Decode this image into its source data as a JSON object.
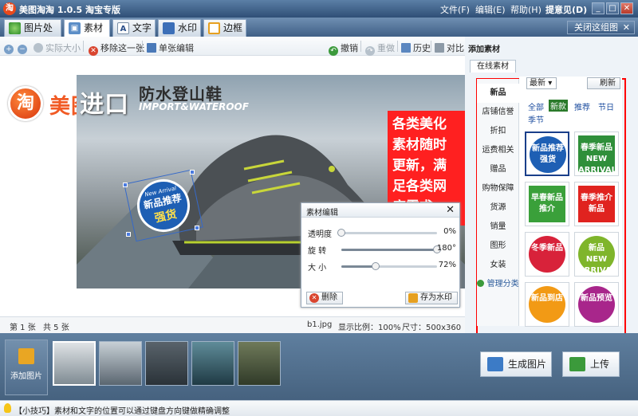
{
  "window": {
    "title": "美图淘淘 1.0.5 淘宝专版",
    "logo_char": "淘",
    "menu": [
      "文件(F)",
      "编辑(E)",
      "帮助(H)",
      "提意见(D)"
    ],
    "controls": [
      "_",
      "□",
      "✕"
    ]
  },
  "tabs": [
    {
      "label": "图片处理",
      "active": false
    },
    {
      "label": "素材",
      "active": true
    },
    {
      "label": "文字",
      "active": false
    },
    {
      "label": "水印",
      "active": false
    },
    {
      "label": "边框",
      "active": false
    }
  ],
  "close_panel_label": "关闭这组图",
  "toolbar": {
    "actual_size": "实际大小",
    "remove_one": "移除这一张",
    "single_edit": "单张编辑",
    "undo": "撤销",
    "redo": "重做",
    "history": "历史",
    "compare": "对比"
  },
  "canvas": {
    "brand_char": "淘",
    "brand_name": "美图淘淘",
    "headline_big": "进口",
    "headline_small": "防水登山鞋",
    "subhead": "IMPORT&WATEROOF",
    "sticker_small": "New Arrival",
    "sticker_mid": "新品推荐",
    "sticker_big": "强货"
  },
  "promo_lines": [
    "各类美化",
    "素材随时",
    "更新，满",
    "足各类网",
    "店需求"
  ],
  "status": {
    "page": "第 1 张",
    "total": "共 5 张",
    "file": "b1.jpg",
    "zoom": "显示比例：100%",
    "size": "尺寸：500x360"
  },
  "material_editor": {
    "title": "素材编辑",
    "close": "✕",
    "rows": [
      {
        "label": "透明度",
        "value": "0%",
        "level": 0.0
      },
      {
        "label": "旋 转",
        "value": "180°",
        "level": 1.0
      },
      {
        "label": "大 小",
        "value": "72%",
        "level": 0.36
      }
    ],
    "delete_label": "删除",
    "save_watermark_label": "存为水印"
  },
  "right_panel": {
    "title": "添加素材",
    "online_tab": "在线素材",
    "sort": "最新",
    "refresh": "刷新",
    "categories": [
      "新品",
      "店铺信誉",
      "折扣",
      "运费相关",
      "赠品",
      "购物保障",
      "货源",
      "销量",
      "图形",
      "女装",
      "管理分类"
    ],
    "active_category": "新品",
    "filters": [
      "全部",
      "新款",
      "推荐",
      "节日",
      "季节"
    ],
    "active_filter": "新款",
    "tiles": [
      {
        "text": "新品推荐强货",
        "color": "#1e5fb4"
      },
      {
        "text": "春季新品NEW ARRIVAL",
        "color": "#2f8f3a"
      },
      {
        "text": "早春新品推介",
        "color": "#3aa03a"
      },
      {
        "text": "春季推介新品",
        "color": "#e0231f"
      },
      {
        "text": "冬季新品",
        "color": "#d8223a"
      },
      {
        "text": "新品NEW ARRIVAL",
        "color": "#7fb52b"
      },
      {
        "text": "新品到店",
        "color": "#f29a15"
      },
      {
        "text": "新品预览",
        "color": "#a8268b"
      }
    ]
  },
  "strip": {
    "add_label": "添加图片",
    "thumb_count": 5
  },
  "buttons": {
    "generate": "生成图片",
    "upload": "上传"
  },
  "tip": "【小技巧】素材和文字的位置可以通过键盘方向键做精确调整",
  "colors": {
    "accent_red": "#ff2020",
    "brand_orange": "#f15a24",
    "title_bar": "#2f4f76"
  }
}
